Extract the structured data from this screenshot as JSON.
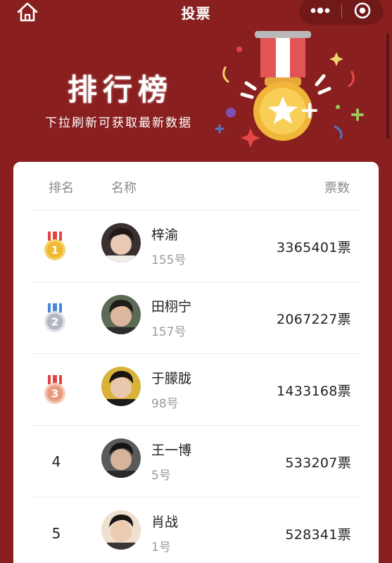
{
  "nav": {
    "title": "投票"
  },
  "header": {
    "title": "排行榜",
    "subtitle": "下拉刷新可获取最新数据"
  },
  "table": {
    "col_rank": "排名",
    "col_name": "名称",
    "col_votes": "票数",
    "rows": [
      {
        "rank": "1",
        "name": "梓渝",
        "number": "155号",
        "votes": "3365401票",
        "medal": "gold"
      },
      {
        "rank": "2",
        "name": "田栩宁",
        "number": "157号",
        "votes": "2067227票",
        "medal": "silver"
      },
      {
        "rank": "3",
        "name": "于朦胧",
        "number": "98号",
        "votes": "1433168票",
        "medal": "bronze"
      },
      {
        "rank": "4",
        "name": "王一博",
        "number": "5号",
        "votes": "533207票",
        "medal": ""
      },
      {
        "rank": "5",
        "name": "肖战",
        "number": "1号",
        "votes": "528341票",
        "medal": ""
      }
    ]
  },
  "colors": {
    "background": "#8a1f1f",
    "gold": "#f2c23a",
    "silver": "#b9bcc4",
    "bronze": "#e9a08a",
    "ribbon_red": "#e04545",
    "ribbon_blue": "#4a86d8"
  },
  "icons": [
    "home-icon",
    "more-icon",
    "close-circle-icon",
    "medal-icon"
  ]
}
